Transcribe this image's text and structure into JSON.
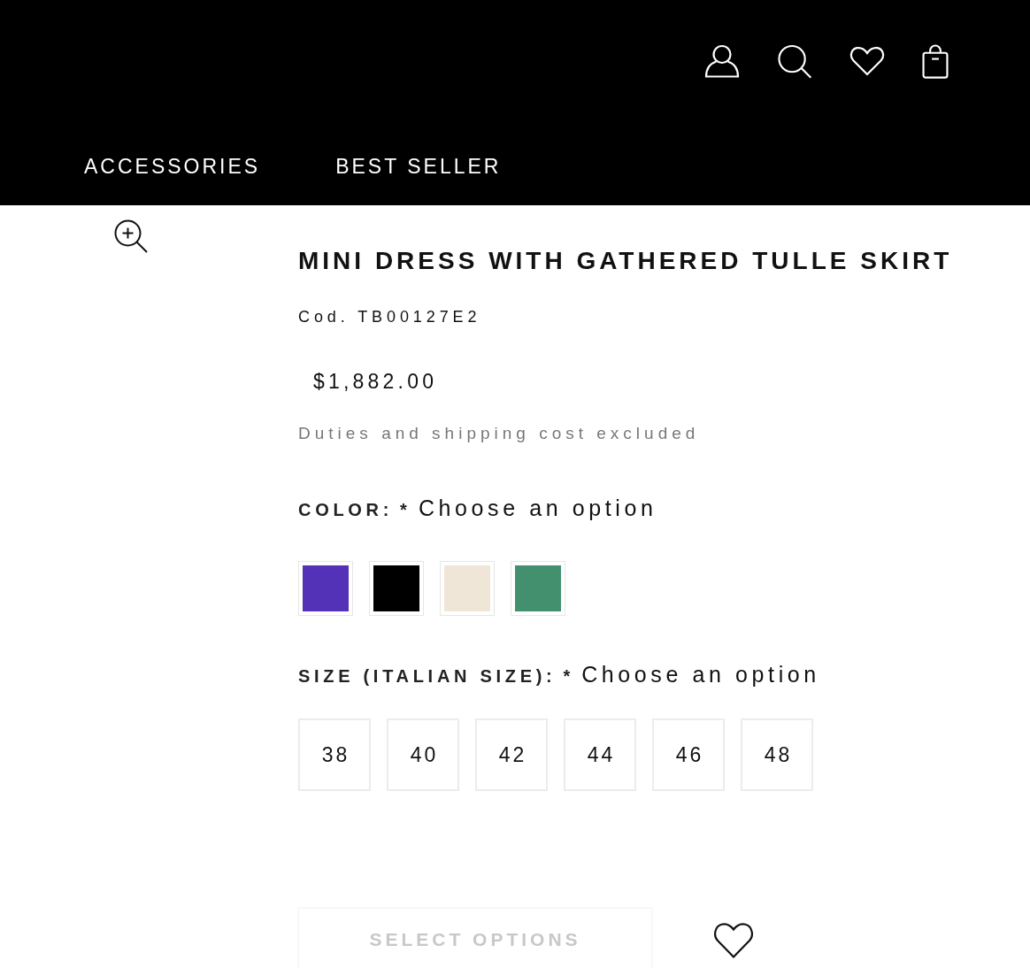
{
  "nav": {
    "items": [
      {
        "label": "ACCESSORIES"
      },
      {
        "label": "BEST SELLER"
      }
    ]
  },
  "product": {
    "title": "MINI DRESS WITH GATHERED TULLE SKIRT",
    "code": "Cod. TB00127E2",
    "price": "$1,882.00",
    "shipping_note": "Duties and shipping cost excluded"
  },
  "color_option": {
    "label": "COLOR:",
    "required_mark": "*",
    "prompt": "Choose an option",
    "swatches": [
      {
        "color": "#5332b8",
        "selected": false
      },
      {
        "color": "#000000",
        "selected": false
      },
      {
        "color": "#f0e6d8",
        "selected": false
      },
      {
        "color": "#43906f",
        "selected": false
      }
    ]
  },
  "size_option": {
    "label": "SIZE (ITALIAN SIZE):",
    "required_mark": "*",
    "prompt": "Choose an option",
    "sizes": [
      {
        "label": "38",
        "selected": false
      },
      {
        "label": "40",
        "selected": false
      },
      {
        "label": "42",
        "selected": false
      },
      {
        "label": "44",
        "selected": false
      },
      {
        "label": "46",
        "selected": false
      },
      {
        "label": "48",
        "selected": false
      }
    ]
  },
  "actions": {
    "add_button": {
      "label": "SELECT OPTIONS",
      "disabled": true
    }
  }
}
